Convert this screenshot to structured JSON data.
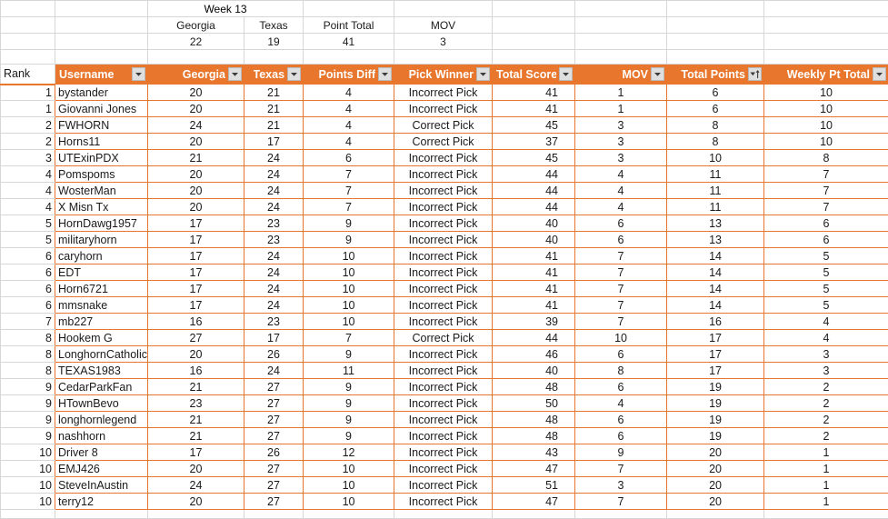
{
  "summary": {
    "title": "Week 13",
    "labels": [
      "Georgia",
      "Texas",
      "Point Total",
      "MOV"
    ],
    "values": [
      "22",
      "19",
      "41",
      "3"
    ]
  },
  "table": {
    "rank_header": "Rank",
    "columns": [
      {
        "label": "Username",
        "filter": "filter-dropdown",
        "align": "left"
      },
      {
        "label": "Georgia",
        "filter": "filter-dropdown",
        "align": "center"
      },
      {
        "label": "Texas",
        "filter": "filter-dropdown",
        "align": "center"
      },
      {
        "label": "Points Diff",
        "filter": "filter-dropdown",
        "align": "center"
      },
      {
        "label": "Pick Winner",
        "filter": "filter-dropdown",
        "align": "center"
      },
      {
        "label": "Total Score",
        "filter": "filter-dropdown",
        "align": "center"
      },
      {
        "label": "MOV",
        "filter": "filter-dropdown",
        "align": "center"
      },
      {
        "label": "Total Points",
        "filter": "sort-ascending",
        "align": "center"
      },
      {
        "label": "Weekly Pt Total",
        "filter": "filter-dropdown",
        "align": "center"
      }
    ],
    "rows": [
      {
        "rank": "1",
        "username": "bystander",
        "georgia": "20",
        "texas": "21",
        "points_diff": "4",
        "pick_winner": "Incorrect Pick",
        "total_score": "41",
        "mov": "1",
        "total_points": "6",
        "weekly_pt_total": "10"
      },
      {
        "rank": "1",
        "username": "Giovanni Jones",
        "georgia": "20",
        "texas": "21",
        "points_diff": "4",
        "pick_winner": "Incorrect Pick",
        "total_score": "41",
        "mov": "1",
        "total_points": "6",
        "weekly_pt_total": "10"
      },
      {
        "rank": "2",
        "username": "FWHORN",
        "georgia": "24",
        "texas": "21",
        "points_diff": "4",
        "pick_winner": "Correct Pick",
        "total_score": "45",
        "mov": "3",
        "total_points": "8",
        "weekly_pt_total": "10"
      },
      {
        "rank": "2",
        "username": "Horns11",
        "georgia": "20",
        "texas": "17",
        "points_diff": "4",
        "pick_winner": "Correct Pick",
        "total_score": "37",
        "mov": "3",
        "total_points": "8",
        "weekly_pt_total": "10"
      },
      {
        "rank": "3",
        "username": "UTExinPDX",
        "georgia": "21",
        "texas": "24",
        "points_diff": "6",
        "pick_winner": "Incorrect Pick",
        "total_score": "45",
        "mov": "3",
        "total_points": "10",
        "weekly_pt_total": "8"
      },
      {
        "rank": "4",
        "username": "Pomspoms",
        "georgia": "20",
        "texas": "24",
        "points_diff": "7",
        "pick_winner": "Incorrect Pick",
        "total_score": "44",
        "mov": "4",
        "total_points": "11",
        "weekly_pt_total": "7"
      },
      {
        "rank": "4",
        "username": "WosterMan",
        "georgia": "20",
        "texas": "24",
        "points_diff": "7",
        "pick_winner": "Incorrect Pick",
        "total_score": "44",
        "mov": "4",
        "total_points": "11",
        "weekly_pt_total": "7"
      },
      {
        "rank": "4",
        "username": "X Misn Tx",
        "georgia": "20",
        "texas": "24",
        "points_diff": "7",
        "pick_winner": "Incorrect Pick",
        "total_score": "44",
        "mov": "4",
        "total_points": "11",
        "weekly_pt_total": "7"
      },
      {
        "rank": "5",
        "username": "HornDawg1957",
        "georgia": "17",
        "texas": "23",
        "points_diff": "9",
        "pick_winner": "Incorrect Pick",
        "total_score": "40",
        "mov": "6",
        "total_points": "13",
        "weekly_pt_total": "6"
      },
      {
        "rank": "5",
        "username": "militaryhorn",
        "georgia": "17",
        "texas": "23",
        "points_diff": "9",
        "pick_winner": "Incorrect Pick",
        "total_score": "40",
        "mov": "6",
        "total_points": "13",
        "weekly_pt_total": "6"
      },
      {
        "rank": "6",
        "username": "caryhorn",
        "georgia": "17",
        "texas": "24",
        "points_diff": "10",
        "pick_winner": "Incorrect Pick",
        "total_score": "41",
        "mov": "7",
        "total_points": "14",
        "weekly_pt_total": "5"
      },
      {
        "rank": "6",
        "username": "EDT",
        "georgia": "17",
        "texas": "24",
        "points_diff": "10",
        "pick_winner": "Incorrect Pick",
        "total_score": "41",
        "mov": "7",
        "total_points": "14",
        "weekly_pt_total": "5"
      },
      {
        "rank": "6",
        "username": "Horn6721",
        "georgia": "17",
        "texas": "24",
        "points_diff": "10",
        "pick_winner": "Incorrect Pick",
        "total_score": "41",
        "mov": "7",
        "total_points": "14",
        "weekly_pt_total": "5"
      },
      {
        "rank": "6",
        "username": "mmsnake",
        "georgia": "17",
        "texas": "24",
        "points_diff": "10",
        "pick_winner": "Incorrect Pick",
        "total_score": "41",
        "mov": "7",
        "total_points": "14",
        "weekly_pt_total": "5"
      },
      {
        "rank": "7",
        "username": "mb227",
        "georgia": "16",
        "texas": "23",
        "points_diff": "10",
        "pick_winner": "Incorrect Pick",
        "total_score": "39",
        "mov": "7",
        "total_points": "16",
        "weekly_pt_total": "4"
      },
      {
        "rank": "8",
        "username": "Hookem G",
        "georgia": "27",
        "texas": "17",
        "points_diff": "7",
        "pick_winner": "Correct Pick",
        "total_score": "44",
        "mov": "10",
        "total_points": "17",
        "weekly_pt_total": "4"
      },
      {
        "rank": "8",
        "username": "LonghornCatholic",
        "georgia": "20",
        "texas": "26",
        "points_diff": "9",
        "pick_winner": "Incorrect Pick",
        "total_score": "46",
        "mov": "6",
        "total_points": "17",
        "weekly_pt_total": "3"
      },
      {
        "rank": "8",
        "username": "TEXAS1983",
        "georgia": "16",
        "texas": "24",
        "points_diff": "11",
        "pick_winner": "Incorrect Pick",
        "total_score": "40",
        "mov": "8",
        "total_points": "17",
        "weekly_pt_total": "3"
      },
      {
        "rank": "9",
        "username": "CedarParkFan",
        "georgia": "21",
        "texas": "27",
        "points_diff": "9",
        "pick_winner": "Incorrect Pick",
        "total_score": "48",
        "mov": "6",
        "total_points": "19",
        "weekly_pt_total": "2"
      },
      {
        "rank": "9",
        "username": "HTownBevo",
        "georgia": "23",
        "texas": "27",
        "points_diff": "9",
        "pick_winner": "Incorrect Pick",
        "total_score": "50",
        "mov": "4",
        "total_points": "19",
        "weekly_pt_total": "2"
      },
      {
        "rank": "9",
        "username": "longhornlegend",
        "georgia": "21",
        "texas": "27",
        "points_diff": "9",
        "pick_winner": "Incorrect Pick",
        "total_score": "48",
        "mov": "6",
        "total_points": "19",
        "weekly_pt_total": "2"
      },
      {
        "rank": "9",
        "username": "nashhorn",
        "georgia": "21",
        "texas": "27",
        "points_diff": "9",
        "pick_winner": "Incorrect Pick",
        "total_score": "48",
        "mov": "6",
        "total_points": "19",
        "weekly_pt_total": "2"
      },
      {
        "rank": "10",
        "username": "Driver 8",
        "georgia": "17",
        "texas": "26",
        "points_diff": "12",
        "pick_winner": "Incorrect Pick",
        "total_score": "43",
        "mov": "9",
        "total_points": "20",
        "weekly_pt_total": "1"
      },
      {
        "rank": "10",
        "username": "EMJ426",
        "georgia": "20",
        "texas": "27",
        "points_diff": "10",
        "pick_winner": "Incorrect Pick",
        "total_score": "47",
        "mov": "7",
        "total_points": "20",
        "weekly_pt_total": "1"
      },
      {
        "rank": "10",
        "username": "SteveInAustin",
        "georgia": "24",
        "texas": "27",
        "points_diff": "10",
        "pick_winner": "Incorrect Pick",
        "total_score": "51",
        "mov": "3",
        "total_points": "20",
        "weekly_pt_total": "1"
      },
      {
        "rank": "10",
        "username": "terry12",
        "georgia": "20",
        "texas": "27",
        "points_diff": "10",
        "pick_winner": "Incorrect Pick",
        "total_score": "47",
        "mov": "7",
        "total_points": "20",
        "weekly_pt_total": "1"
      }
    ]
  },
  "colors": {
    "header_orange": "#E8762C",
    "gridline": "#D6D6D6",
    "text": "#1A1A1A"
  }
}
